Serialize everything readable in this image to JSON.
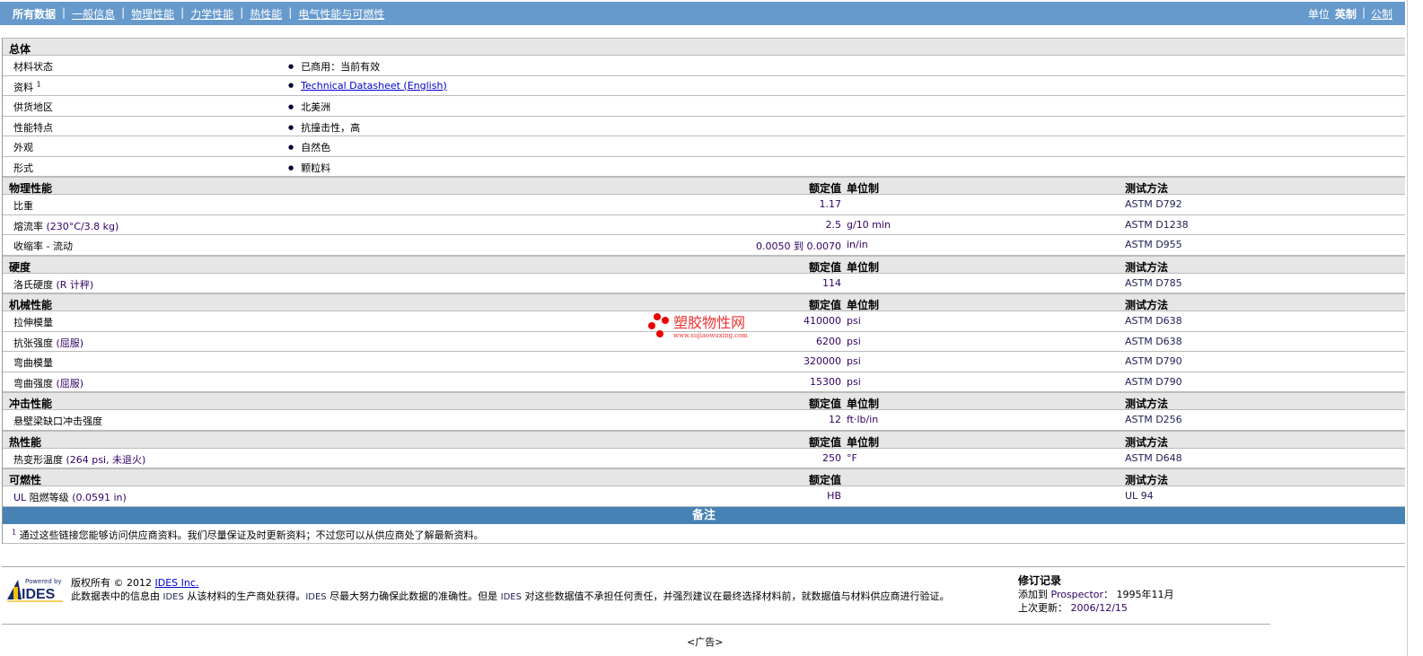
{
  "nav": {
    "tabs": [
      "所有数据",
      "一般信息",
      "物理性能",
      "力学性能",
      "热性能",
      "电气性能与可燃性"
    ],
    "units_label": "单位",
    "unit_english": "英制",
    "unit_metric": "公制"
  },
  "headers": {
    "value": "额定值",
    "unit": "单位制",
    "method": "测试方法"
  },
  "general": {
    "title": "总体",
    "rows": [
      {
        "label": "材料状态",
        "value": "已商用：当前有效"
      },
      {
        "label": "资料",
        "sup": "1",
        "value": "Technical Datasheet (English)",
        "link": true
      },
      {
        "label": "供货地区",
        "value": "北美洲"
      },
      {
        "label": "性能特点",
        "value": "抗撞击性，高"
      },
      {
        "label": "外观",
        "value": "自然色"
      },
      {
        "label": "形式",
        "value": "颗粒料"
      }
    ]
  },
  "sections": [
    {
      "title": "物理性能",
      "unit_header": true,
      "rows": [
        {
          "label": "比重",
          "cond": "",
          "value": "1.17",
          "unit": "",
          "method": "ASTM D792"
        },
        {
          "label": "熔流率",
          "cond": "(230°C/3.8 kg)",
          "value": "2.5",
          "unit": "g/10 min",
          "method": "ASTM D1238"
        },
        {
          "label": "收缩率",
          "cond": "- 流动",
          "value": "0.0050 到  0.0070",
          "unit": "in/in",
          "method": "ASTM D955"
        }
      ]
    },
    {
      "title": "硬度",
      "unit_header": true,
      "rows": [
        {
          "label": "洛氏硬度",
          "cond": "(R 计秤)",
          "value": "114",
          "unit": "",
          "method": "ASTM D785"
        }
      ]
    },
    {
      "title": "机械性能",
      "unit_header": true,
      "rows": [
        {
          "label": "拉伸模量",
          "cond": "",
          "value": "410000",
          "unit": "psi",
          "method": "ASTM D638"
        },
        {
          "label": "抗张强度",
          "cond": "(屈服)",
          "value": "6200",
          "unit": "psi",
          "method": "ASTM D638"
        },
        {
          "label": "弯曲模量",
          "cond": "",
          "value": "320000",
          "unit": "psi",
          "method": "ASTM D790"
        },
        {
          "label": "弯曲强度",
          "cond": "(屈服)",
          "value": "15300",
          "unit": "psi",
          "method": "ASTM D790"
        }
      ]
    },
    {
      "title": "冲击性能",
      "unit_header": true,
      "rows": [
        {
          "label": "悬壁梁缺口冲击强度",
          "cond": "",
          "value": "12",
          "unit": "ft·lb/in",
          "method": "ASTM D256"
        }
      ]
    },
    {
      "title": "热性能",
      "unit_header": true,
      "rows": [
        {
          "label": "热变形温度",
          "cond": "(264 psi, 未退火)",
          "value": "250",
          "unit": "°F",
          "method": "ASTM D648"
        }
      ]
    },
    {
      "title": "可燃性",
      "unit_header": false,
      "rows": [
        {
          "label": "UL 阻燃等级",
          "cond": "(0.0591 in)",
          "value": "HB",
          "unit": "",
          "method": "UL 94"
        }
      ]
    }
  ],
  "notes": {
    "title": "备注",
    "sup": "1",
    "text": "通过这些链接您能够访问供应商资料。我们尽量保证及时更新资料；不过您可以从供应商处了解最新资料。"
  },
  "footer": {
    "logo_text": "Powered by IDES",
    "copyright": "版权所有  © 2012",
    "company_link": "IDES Inc.",
    "disclaimer": [
      "此数据表中的信息由 ",
      "IDES",
      " 从该材料的生产商处获得。",
      "IDES",
      " 尽最大努力确保此数据的准确性。但是 ",
      "IDES",
      " 对这些数据值不承担任何责任，并强烈建议在最终选择材料前，就数据值与材料供应商进行验证。"
    ],
    "revision_title": "修订记录",
    "added_label": "添加到 ",
    "added_prospector": "Prospector",
    "added_colon": "：  ",
    "added_date": "1995年11月",
    "updated_label": "上次更新：  ",
    "updated_date": "2006/12/15"
  },
  "ad": "<广告>",
  "watermark": {
    "text": "塑胶物性网",
    "url": "www.sujiaowuxing.com"
  },
  "colors": {
    "topbar": "#6699cc",
    "notes": "#4682b4",
    "section": "#e6e6e6"
  }
}
